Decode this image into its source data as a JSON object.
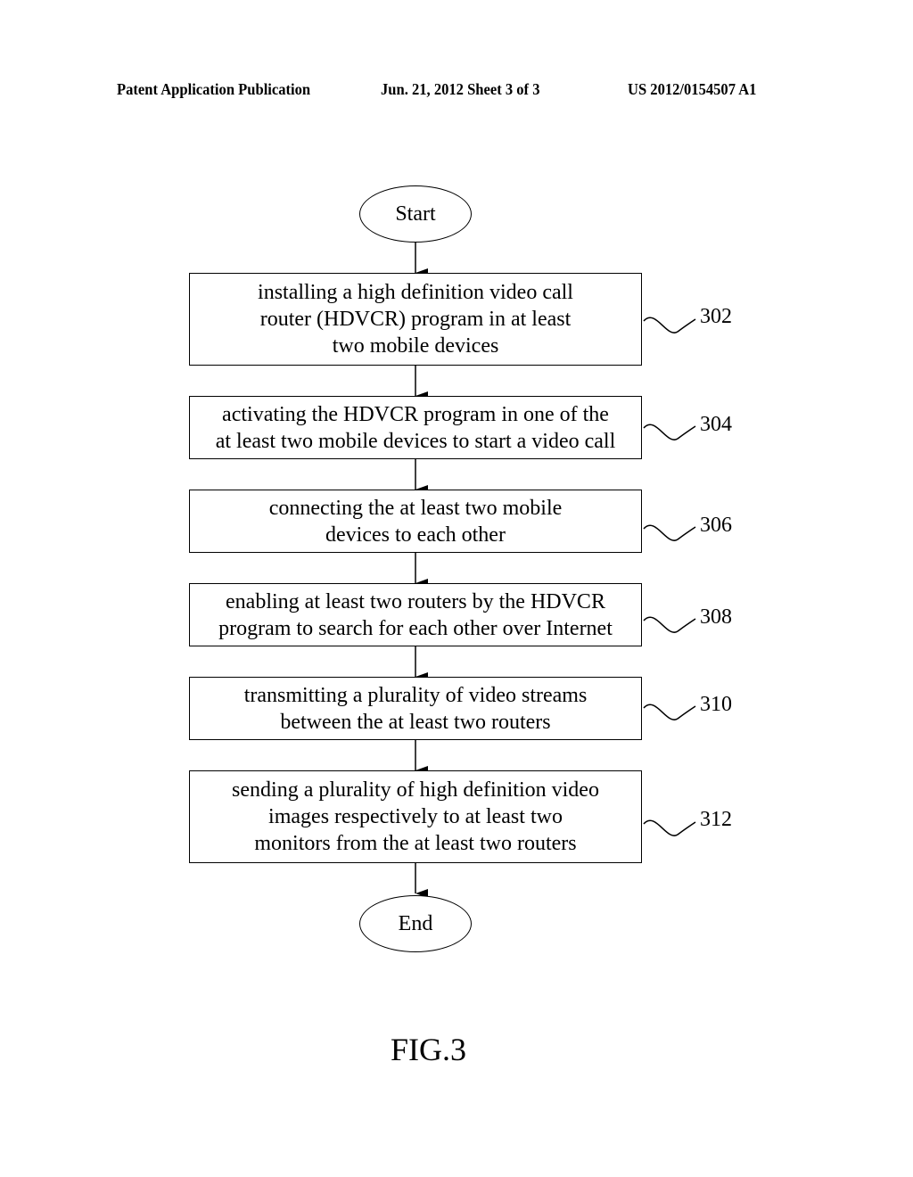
{
  "header": {
    "publication": "Patent Application Publication",
    "date_sheet": "Jun. 21, 2012  Sheet 3 of 3",
    "number": "US 2012/0154507 A1"
  },
  "flowchart": {
    "start": "Start",
    "end": "End",
    "steps": [
      {
        "id": "302",
        "lines": [
          "installing a high definition video call",
          "router (HDVCR) program in at least",
          "two mobile devices"
        ]
      },
      {
        "id": "304",
        "lines": [
          "activating the HDVCR program in one of the",
          "at least two mobile devices to start a video call"
        ]
      },
      {
        "id": "306",
        "lines": [
          "connecting the at least two mobile",
          "devices to each other"
        ]
      },
      {
        "id": "308",
        "lines": [
          "enabling at least two routers by the HDVCR",
          "program to search for each other over Internet"
        ]
      },
      {
        "id": "310",
        "lines": [
          "transmitting a plurality of video streams",
          "between the at least two routers"
        ]
      },
      {
        "id": "312",
        "lines": [
          "sending a plurality of high definition video",
          "images respectively to at least two",
          "monitors from the at least two routers"
        ]
      }
    ]
  },
  "figure_label": "FIG.3"
}
